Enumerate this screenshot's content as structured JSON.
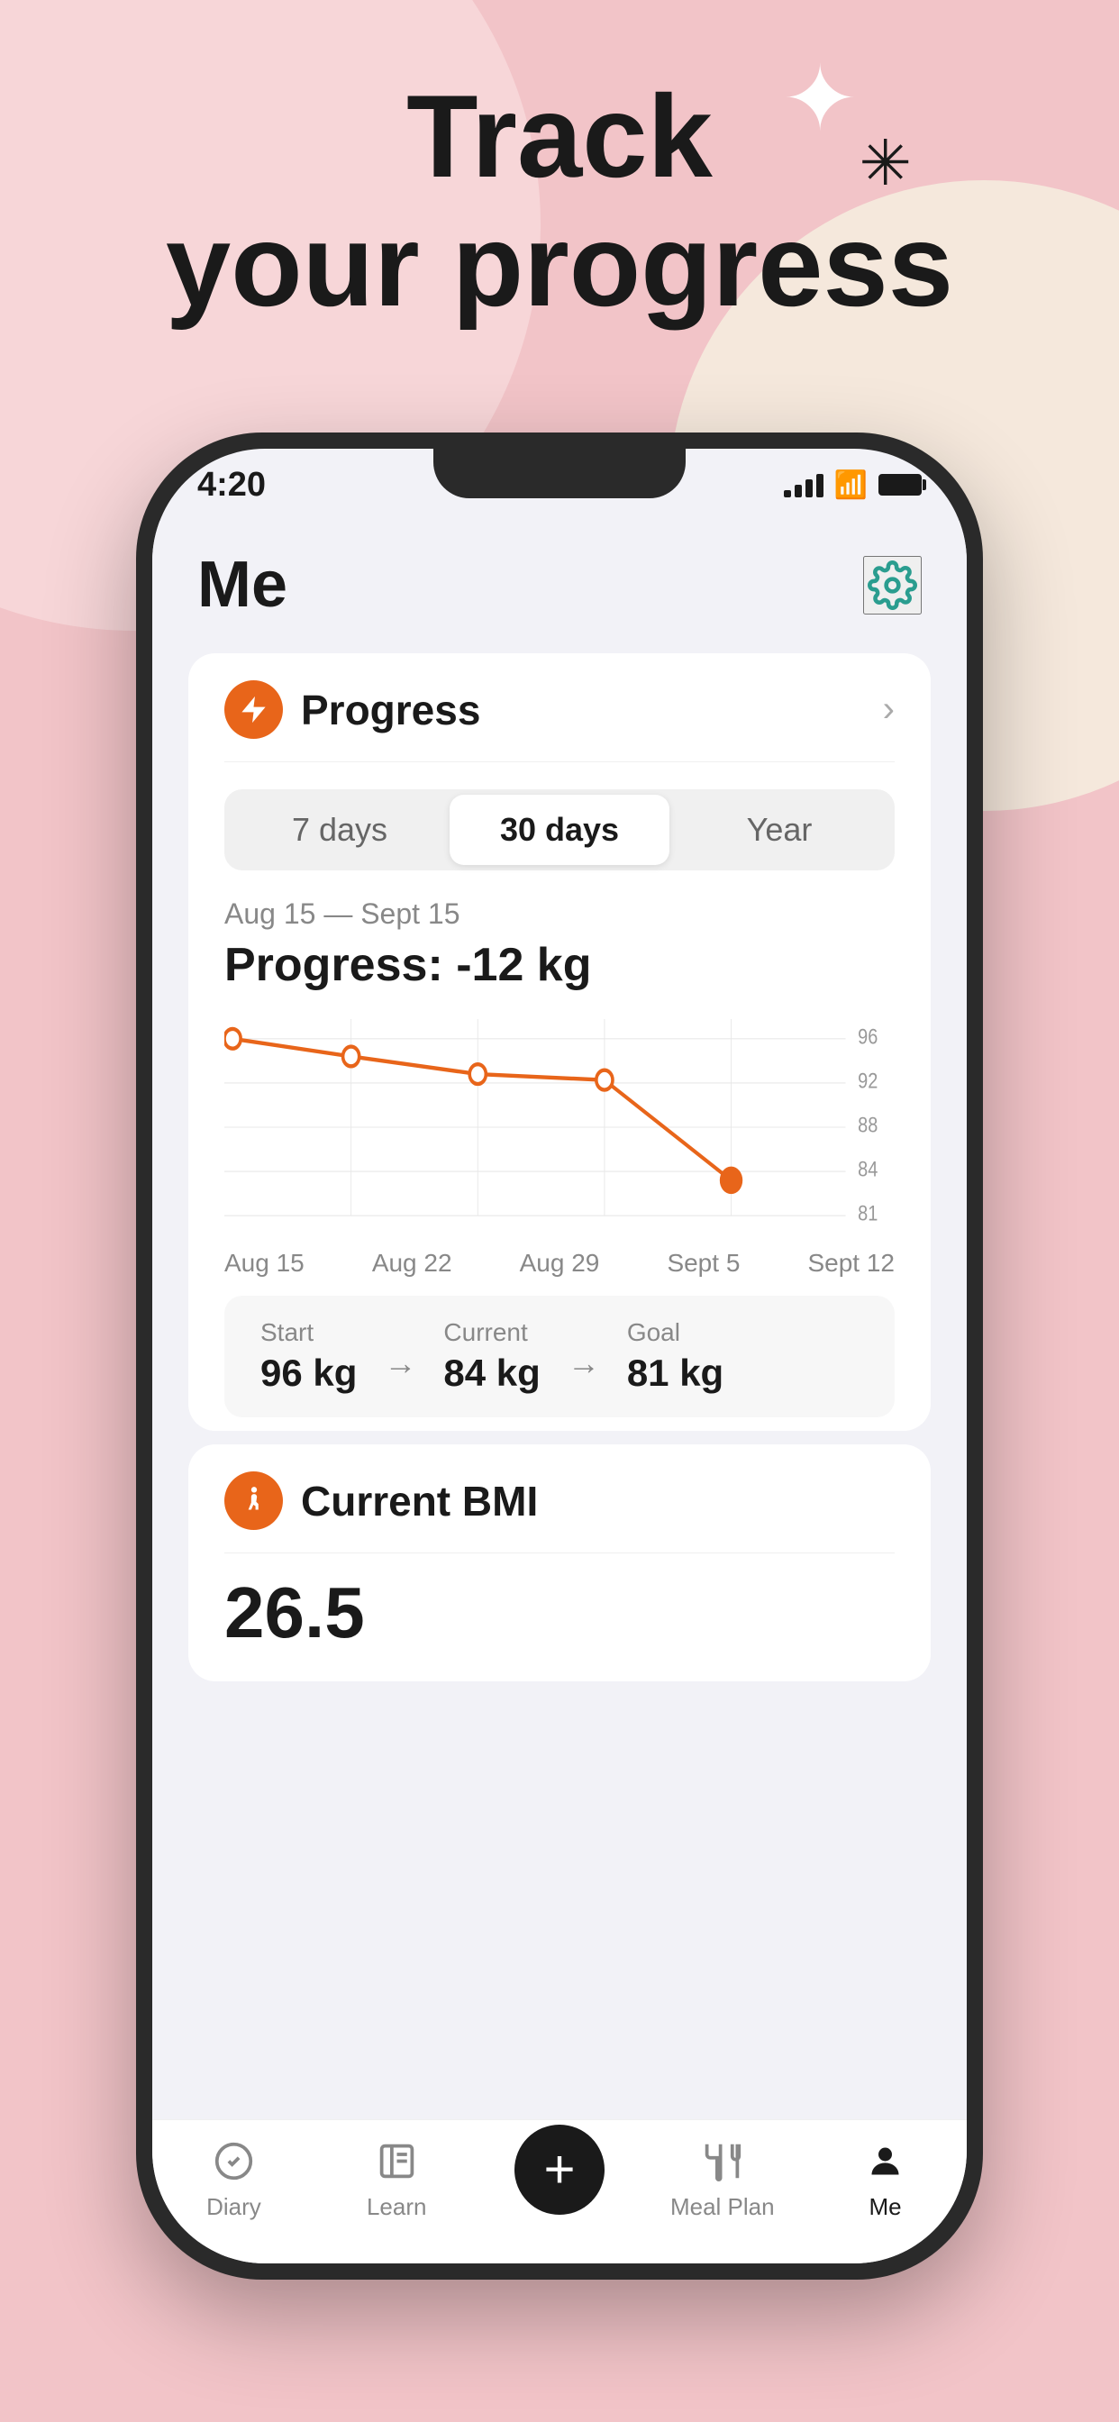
{
  "background": {
    "color": "#f2c4c8"
  },
  "hero": {
    "line1": "Track",
    "line2": "your progress"
  },
  "phone": {
    "statusBar": {
      "time": "4:20"
    },
    "header": {
      "title": "Me",
      "settingsLabel": "settings"
    },
    "progressCard": {
      "title": "Progress",
      "tabs": [
        "7 days",
        "30 days",
        "Year"
      ],
      "activeTab": 1,
      "dateRange": "Aug 15 — Sept 15",
      "progressLabel": "Progress: -12 kg",
      "chartData": {
        "xLabels": [
          "Aug 15",
          "Aug 22",
          "Aug 29",
          "Sept 5",
          "Sept 12"
        ],
        "yLabels": [
          "96",
          "92",
          "88",
          "84",
          "81"
        ],
        "points": [
          {
            "x": 0,
            "y": 96
          },
          {
            "x": 1,
            "y": 94.5
          },
          {
            "x": 2,
            "y": 93
          },
          {
            "x": 3,
            "y": 92.5
          },
          {
            "x": 4,
            "y": 84
          }
        ]
      },
      "stats": {
        "start": {
          "label": "Start",
          "value": "96 kg"
        },
        "current": {
          "label": "Current",
          "value": "84 kg"
        },
        "goal": {
          "label": "Goal",
          "value": "81 kg"
        }
      }
    },
    "bmiCard": {
      "title": "Current BMI",
      "value": "26.5"
    },
    "bottomNav": {
      "items": [
        {
          "label": "Diary",
          "icon": "check-circle"
        },
        {
          "label": "Learn",
          "icon": "book"
        },
        {
          "label": "+",
          "icon": "plus"
        },
        {
          "label": "Meal Plan",
          "icon": "meal"
        },
        {
          "label": "Me",
          "icon": "person"
        }
      ],
      "activeItem": 4
    }
  }
}
